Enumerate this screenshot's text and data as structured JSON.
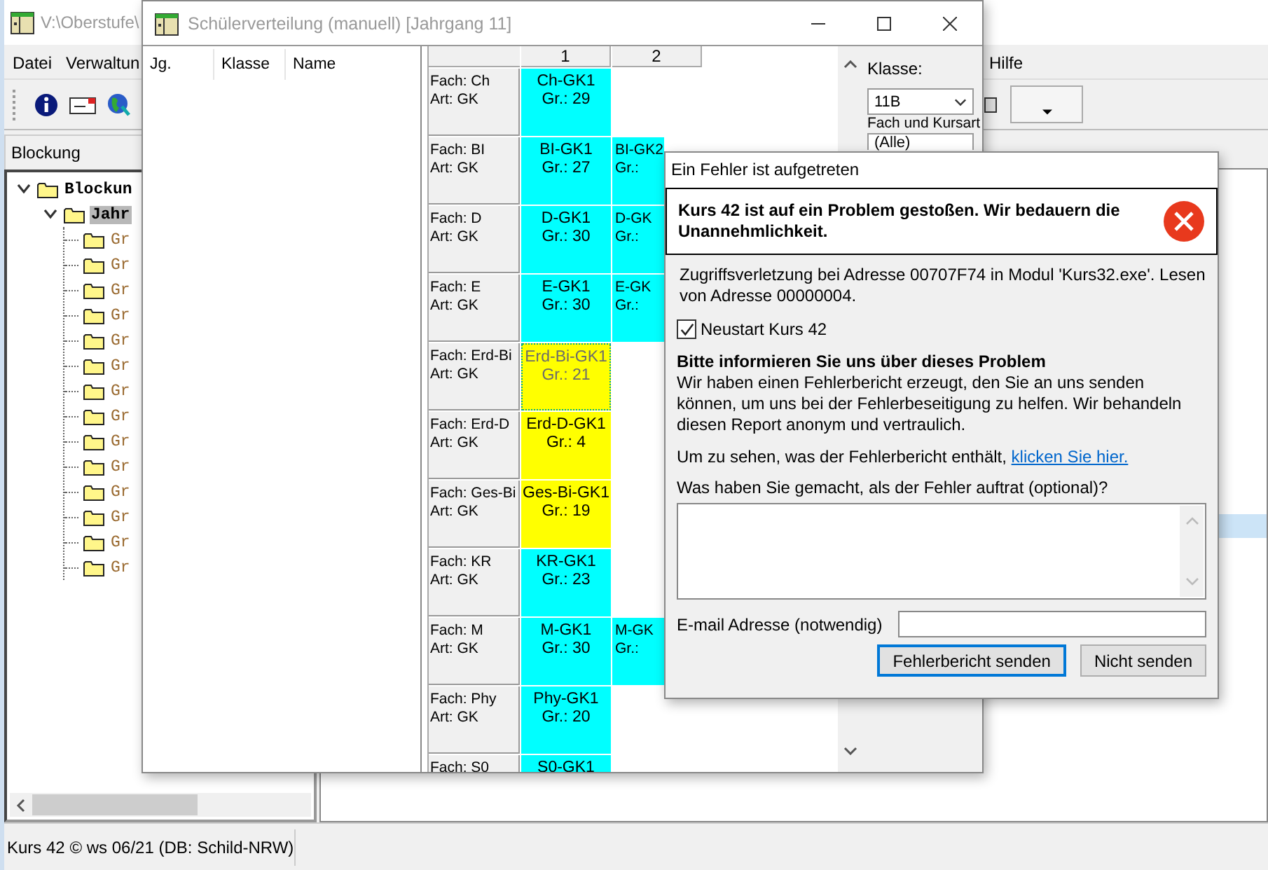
{
  "main_window": {
    "title": "V:\\Oberstufe\\",
    "menu_left": [
      "Datei",
      "Verwaltun"
    ],
    "menu_right": [
      "Hilfe"
    ],
    "panel_title": "Blockung",
    "tree": [
      {
        "label": "Blockun",
        "expanded": true,
        "selected": false,
        "children": [
          {
            "label": "Jahr",
            "expanded": true,
            "selected": true,
            "children": [
              {
                "label": "Gr",
                "selected": false
              },
              {
                "label": "Gr",
                "selected": false
              },
              {
                "label": "Gr",
                "selected": false
              },
              {
                "label": "Gr",
                "selected": false
              },
              {
                "label": "Gr",
                "selected": false
              },
              {
                "label": "Gr",
                "selected": false
              },
              {
                "label": "Gr",
                "selected": false
              },
              {
                "label": "Gr",
                "selected": false
              },
              {
                "label": "Gr",
                "selected": false
              },
              {
                "label": "Gr",
                "selected": false
              },
              {
                "label": "Gr",
                "selected": false
              },
              {
                "label": "Gr",
                "selected": false
              },
              {
                "label": "Gr",
                "selected": false
              },
              {
                "label": "Gr",
                "selected": false
              }
            ]
          }
        ]
      }
    ],
    "status_bar": "Kurs 42 © ws 06/21 (DB: Schild-NRW)"
  },
  "distribution_window": {
    "title": "Schülerverteilung (manuell) [Jahrgang 11]",
    "list_columns": [
      "Jg.",
      "Klasse",
      "Name"
    ],
    "grid_columns": [
      "1",
      "2"
    ],
    "rows": [
      {
        "subject": "Fach: Ch",
        "type": "Art: GK",
        "cells": [
          {
            "name": "Ch-GK1",
            "size": "Gr.: 29",
            "color": "#00ffff",
            "selected": false
          },
          null
        ]
      },
      {
        "subject": "Fach: BI",
        "type": "Art: GK",
        "cells": [
          {
            "name": "BI-GK1",
            "size": "Gr.: 27",
            "color": "#00ffff",
            "selected": false
          },
          {
            "name": "BI-GK2",
            "size": "Gr.:",
            "color": "#00ffff",
            "selected": false
          }
        ]
      },
      {
        "subject": "Fach: D",
        "type": "Art: GK",
        "cells": [
          {
            "name": "D-GK1",
            "size": "Gr.: 30",
            "color": "#00ffff",
            "selected": false
          },
          {
            "name": "D-GK",
            "size": "Gr.:",
            "color": "#00ffff",
            "selected": false
          }
        ]
      },
      {
        "subject": "Fach: E",
        "type": "Art: GK",
        "cells": [
          {
            "name": "E-GK1",
            "size": "Gr.: 30",
            "color": "#00ffff",
            "selected": false
          },
          {
            "name": "E-GK",
            "size": "Gr.:",
            "color": "#00ffff",
            "selected": false
          }
        ]
      },
      {
        "subject": "Fach: Erd-Bi",
        "type": "Art: GK",
        "cells": [
          {
            "name": "Erd-Bi-GK1",
            "size": "Gr.: 21",
            "color": "#ffff00",
            "selected": true
          },
          null
        ]
      },
      {
        "subject": "Fach: Erd-D",
        "type": "Art: GK",
        "cells": [
          {
            "name": "Erd-D-GK1",
            "size": "Gr.: 4",
            "color": "#ffff00",
            "selected": false
          },
          null
        ]
      },
      {
        "subject": "Fach: Ges-Bi",
        "type": "Art: GK",
        "cells": [
          {
            "name": "Ges-Bi-GK1",
            "size": "Gr.: 19",
            "color": "#ffff00",
            "selected": false
          },
          null
        ]
      },
      {
        "subject": "Fach: KR",
        "type": "Art: GK",
        "cells": [
          {
            "name": "KR-GK1",
            "size": "Gr.: 23",
            "color": "#00ffff",
            "selected": false
          },
          null
        ]
      },
      {
        "subject": "Fach: M",
        "type": "Art: GK",
        "cells": [
          {
            "name": "M-GK1",
            "size": "Gr.: 30",
            "color": "#00ffff",
            "selected": false
          },
          {
            "name": "M-GK",
            "size": "Gr.:",
            "color": "#00ffff",
            "selected": false
          }
        ]
      },
      {
        "subject": "Fach: Phy",
        "type": "Art: GK",
        "cells": [
          {
            "name": "Phy-GK1",
            "size": "Gr.: 20",
            "color": "#00ffff",
            "selected": false
          },
          null
        ]
      },
      {
        "subject": "Fach: S0",
        "cells": [
          {
            "name": "S0-GK1",
            "color": "#00ffff",
            "selected": false
          },
          null
        ]
      }
    ],
    "class_label": "Klasse:",
    "class_value": "11B",
    "subject_label": "Fach und Kursart",
    "subject_value": "(Alle)"
  },
  "error_dialog": {
    "title": "Ein Fehler ist aufgetreten",
    "heading": "Kurs 42 ist auf ein Problem gestoßen. Wir bedauern die Unannehmlichkeit.",
    "message": "Zugriffsverletzung bei Adresse 00707F74 in Modul 'Kurs32.exe'. Lesen von Adresse 00000004.",
    "restart_checkbox": {
      "label": "Neustart Kurs 42",
      "checked": true
    },
    "section_title": "Bitte informieren Sie uns über dieses Problem",
    "section_text": "Wir haben einen Fehlerbericht erzeugt, den Sie an uns senden können, um uns bei der Fehlerbeseitigung zu helfen. Wir behandeln diesen Report anonym und vertraulich.",
    "details_text": "Um zu sehen, was der Fehlerbericht enthält,",
    "details_link": "klicken Sie hier.",
    "comment_label": "Was haben Sie gemacht, als der Fehler auftrat (optional)?",
    "email_label": "E-mail Adresse (notwendig)",
    "buttons": [
      {
        "label": "Fehlerbericht senden",
        "default": true
      },
      {
        "label": "Nicht senden",
        "default": false
      }
    ]
  }
}
